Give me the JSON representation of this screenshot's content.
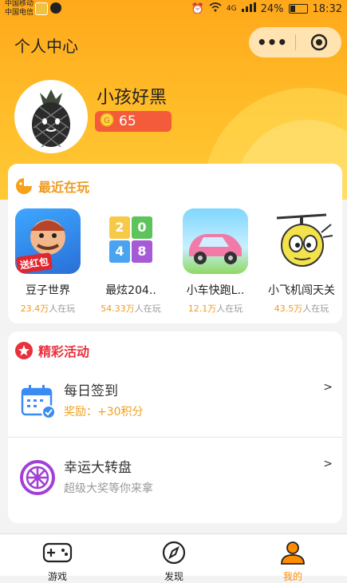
{
  "status_bar": {
    "carrier_1": "中国移动",
    "carrier_2": "中国电信",
    "network": "4G",
    "battery": "24%",
    "time": "18:32"
  },
  "header": {
    "title": "个人中心"
  },
  "profile": {
    "username": "小孩好黑",
    "coins": "65"
  },
  "recent": {
    "title": "最近在玩",
    "games": [
      {
        "name": "豆子世界",
        "players_num": "23.4万",
        "players_suffix": "人在玩",
        "badge": "送红包"
      },
      {
        "name": "最炫204..",
        "players_num": "54.33万",
        "players_suffix": "人在玩",
        "tiles": [
          "2",
          "0",
          "4",
          "8"
        ]
      },
      {
        "name": "小车快跑L..",
        "players_num": "12.1万",
        "players_suffix": "人在玩"
      },
      {
        "name": "小飞机闯天关",
        "players_num": "43.5万",
        "players_suffix": "人在玩"
      }
    ]
  },
  "events": {
    "title": "精彩活动",
    "items": [
      {
        "title": "每日签到",
        "subtitle": "奖励：+30积分",
        "arrow": ">"
      },
      {
        "title": "幸运大转盘",
        "subtitle": "超级大奖等你来拿",
        "arrow": ">"
      }
    ]
  },
  "tabbar": {
    "items": [
      {
        "label": "游戏"
      },
      {
        "label": "发现"
      },
      {
        "label": "我的"
      }
    ]
  },
  "colors": {
    "accent": "#ffa81a",
    "coin_pill": "#f45b3b",
    "players_highlight": "#f09a1e",
    "reward_text": "#f0a020",
    "event_icon": "#e8313c",
    "tab_active": "#ff8c00"
  },
  "icons": [
    "more-icon",
    "target-icon",
    "gamepad-icon",
    "compass-icon",
    "user-icon",
    "calendar-check-icon",
    "wheel-icon",
    "star-icon",
    "game-face-icon",
    "coin-icon"
  ]
}
